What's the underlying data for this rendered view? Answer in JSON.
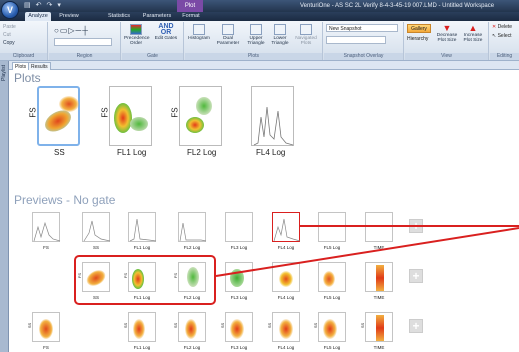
{
  "app": {
    "title": "VenturiOne - AS SC 2L Verify 8-4-3-45-19 007.LMD - Untitled Workspace",
    "orb_glyph": "V",
    "contextual_tab": "Plot"
  },
  "ribbon_tabs": [
    "Analyze",
    "Preview",
    "Statistics",
    "Parameters",
    "Format"
  ],
  "ribbon": {
    "clipboard": {
      "label": "Clipboard",
      "paste": "Paste",
      "cut": "Cut",
      "copy": "Copy"
    },
    "region": {
      "label": "Region"
    },
    "gate": {
      "label": "Gate",
      "precedence": "Precedence Order",
      "edit": "Edit Gates",
      "and": "AND",
      "or": "OR"
    },
    "plots": {
      "label": "Plots",
      "histogram": "Histogram",
      "dual": "Dual Parameter",
      "upper": "Upper Triangle",
      "lower": "Lower Triangle",
      "navigated": "Navigated Plots"
    },
    "snapshot": {
      "label": "Snapshot Overlay",
      "new": "New Snapshot"
    },
    "view": {
      "label": "View",
      "gallery": "Gallery",
      "hierarchy": "Hierarchy",
      "decrease": "Decrease Plot Size",
      "increase": "Increase Plot Size"
    },
    "editing": {
      "label": "Editing",
      "delete": "Delete",
      "select": "Select"
    }
  },
  "side_panel": {
    "label": "Playlist"
  },
  "subtabs": [
    "Plots",
    "Results"
  ],
  "sections": {
    "plots": "Plots",
    "previews": "Previews - No gate"
  },
  "main_plots": [
    {
      "y": "FS",
      "x": "SS"
    },
    {
      "y": "FS",
      "x": "FL1 Log"
    },
    {
      "y": "FS",
      "x": "FL2 Log"
    },
    {
      "y": "",
      "x": "FL4 Log"
    }
  ],
  "preview_rows": [
    {
      "labels": [
        "FS",
        "SS",
        "FL1 Log",
        "FL2 Log",
        "FL3 Log",
        "FL4 Log",
        "FL5 Log",
        "TIME"
      ]
    },
    {
      "y": "FS",
      "labels": [
        "SS",
        "FL1 Log",
        "FL2 Log",
        "FL3 Log",
        "FL4 Log",
        "FL5 Log",
        "TIME"
      ]
    },
    {
      "y": "SS",
      "labels": [
        "FS",
        "FL1 Log",
        "FL2 Log",
        "FL3 Log",
        "FL4 Log",
        "FL5 Log",
        "TIME"
      ]
    }
  ],
  "colors": {
    "highlight": "#d9201f",
    "selection": "#7fb2ea"
  }
}
